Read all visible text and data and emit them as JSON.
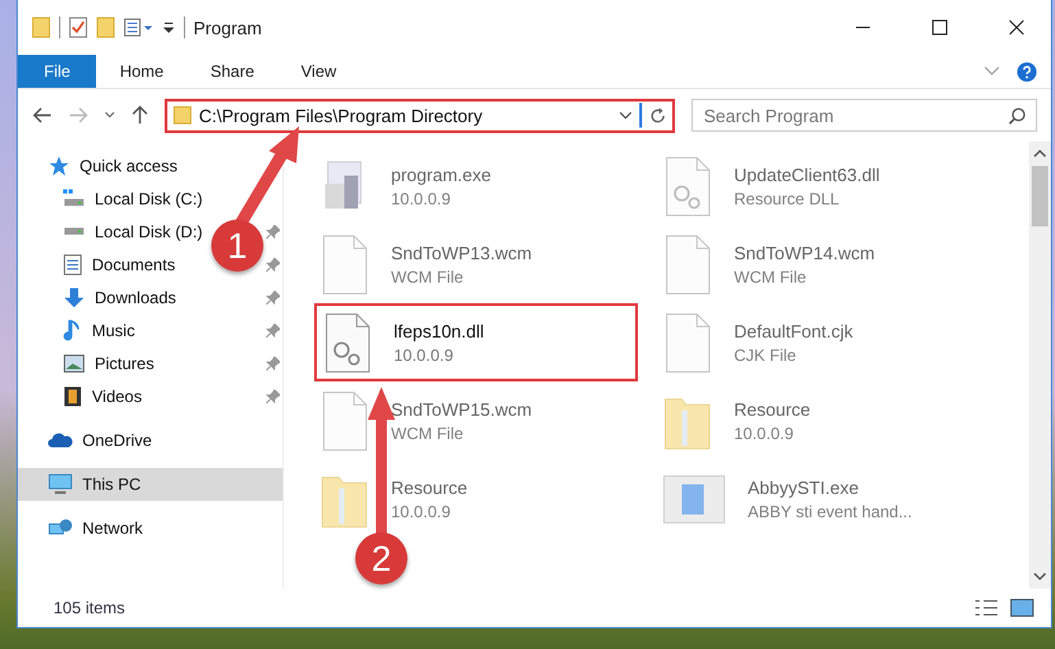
{
  "window": {
    "title": "Program"
  },
  "ribbon_tabs": [
    {
      "label": "File",
      "selected": true
    },
    {
      "label": "Home",
      "selected": false
    },
    {
      "label": "Share",
      "selected": false
    },
    {
      "label": "View",
      "selected": false
    }
  ],
  "address_bar": {
    "path": "C:\\Program Files\\Program Directory",
    "highlighted": true
  },
  "search": {
    "placeholder": "Search Program"
  },
  "sidebar": {
    "items": [
      {
        "label": "Quick access",
        "kind": "star",
        "selected": false,
        "children": [
          {
            "label": "Local Disk (C:)",
            "kind": "system",
            "pinned": false,
            "selected": false
          },
          {
            "label": "Local Disk (D:)",
            "kind": "disk",
            "pinned": true,
            "selected": false
          },
          {
            "label": "Documents",
            "kind": "document",
            "pinned": true,
            "selected": false
          },
          {
            "label": "Downloads",
            "kind": "download",
            "pinned": true,
            "selected": false
          },
          {
            "label": "Music",
            "kind": "music",
            "pinned": true,
            "selected": false
          },
          {
            "label": "Pictures",
            "kind": "picture",
            "pinned": true,
            "selected": false
          },
          {
            "label": "Videos",
            "kind": "video",
            "pinned": true,
            "selected": false
          }
        ]
      },
      {
        "label": "OneDrive",
        "kind": "cloud",
        "selected": false
      },
      {
        "label": "This PC",
        "kind": "computer",
        "selected": true
      },
      {
        "label": "Network",
        "kind": "network",
        "selected": false
      }
    ]
  },
  "files": [
    {
      "name": "program.exe",
      "detail": "10.0.0.9",
      "kind": "exe",
      "dimmed": true,
      "highlighted": false
    },
    {
      "name": "UpdateClient63.dll",
      "detail": "Resource DLL",
      "kind": "dll",
      "dimmed": true,
      "highlighted": false
    },
    {
      "name": "SndToWP13.wcm",
      "detail": "WCM File",
      "kind": "file",
      "dimmed": true,
      "highlighted": false
    },
    {
      "name": "SndToWP14.wcm",
      "detail": "WCM File",
      "kind": "file",
      "dimmed": true,
      "highlighted": false
    },
    {
      "name": "lfeps10n.dll",
      "detail": "10.0.0.9",
      "kind": "dll",
      "dimmed": false,
      "highlighted": true
    },
    {
      "name": "DefaultFont.cjk",
      "detail": "CJK File",
      "kind": "file",
      "dimmed": true,
      "highlighted": false
    },
    {
      "name": "SndToWP15.wcm",
      "detail": "WCM File",
      "kind": "file",
      "dimmed": true,
      "highlighted": false
    },
    {
      "name": "Resource",
      "detail": "10.0.0.9",
      "kind": "folder",
      "dimmed": true,
      "highlighted": false
    },
    {
      "name": "Resource",
      "detail": "10.0.0.9",
      "kind": "folder",
      "dimmed": true,
      "highlighted": false
    },
    {
      "name": "AbbyySTI.exe",
      "detail": "ABBY sti event hand...",
      "kind": "app",
      "dimmed": true,
      "highlighted": false
    }
  ],
  "status_bar": {
    "item_count": "105 items"
  },
  "annotations": [
    {
      "number": "1"
    },
    {
      "number": "2"
    }
  ]
}
